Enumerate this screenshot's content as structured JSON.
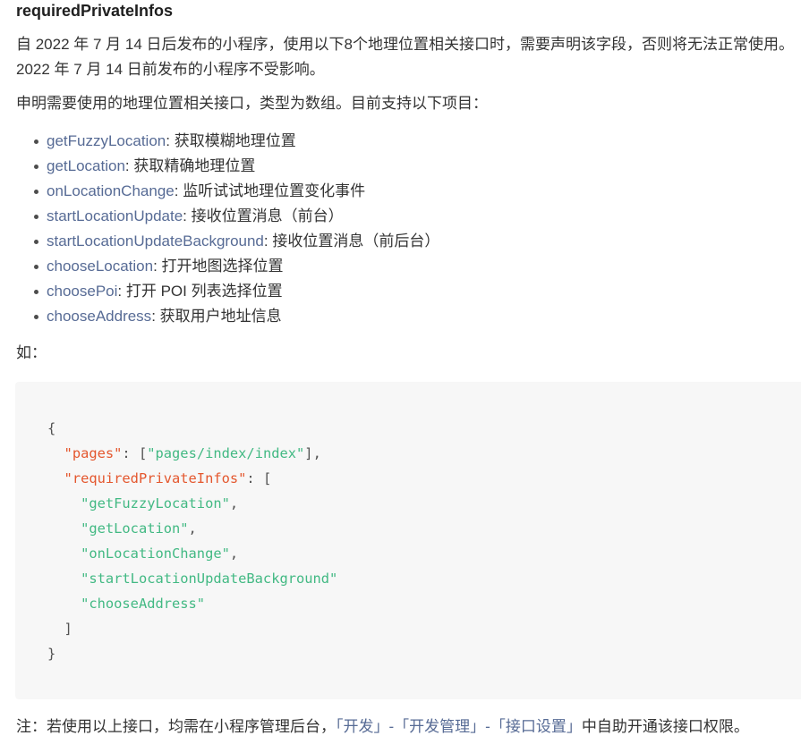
{
  "section": {
    "heading": "requiredPrivateInfos",
    "intro": "自 2022 年 7 月 14 日后发布的小程序，使用以下8个地理位置相关接口时，需要声明该字段，否则将无法正常使用。2022 年 7 月 14 日前发布的小程序不受影响。",
    "list_intro": "申明需要使用的地理位置相关接口，类型为数组。目前支持以下项目："
  },
  "api_list": {
    "separator": ": ",
    "items": [
      {
        "name": "getFuzzyLocation",
        "description": "获取模糊地理位置"
      },
      {
        "name": "getLocation",
        "description": "获取精确地理位置"
      },
      {
        "name": "onLocationChange",
        "description": "监听试试地理位置变化事件"
      },
      {
        "name": "startLocationUpdate",
        "description": "接收位置消息（前台）"
      },
      {
        "name": "startLocationUpdateBackground",
        "description": "接收位置消息（前后台）"
      },
      {
        "name": "chooseLocation",
        "description": "打开地图选择位置"
      },
      {
        "name": "choosePoi",
        "description": "打开 POI 列表选择位置"
      },
      {
        "name": "chooseAddress",
        "description": "获取用户地址信息"
      }
    ]
  },
  "example_label": "如：",
  "code_block": {
    "lines": [
      [
        [
          "punct",
          "{"
        ]
      ],
      [
        [
          "plain",
          "  "
        ],
        [
          "key",
          "\"pages\""
        ],
        [
          "punct",
          ": ["
        ],
        [
          "string",
          "\"pages/index/index\""
        ],
        [
          "punct",
          "],"
        ]
      ],
      [
        [
          "plain",
          "  "
        ],
        [
          "key",
          "\"requiredPrivateInfos\""
        ],
        [
          "punct",
          ": ["
        ]
      ],
      [
        [
          "plain",
          "    "
        ],
        [
          "string",
          "\"getFuzzyLocation\""
        ],
        [
          "punct",
          ","
        ]
      ],
      [
        [
          "plain",
          "    "
        ],
        [
          "string",
          "\"getLocation\""
        ],
        [
          "punct",
          ","
        ]
      ],
      [
        [
          "plain",
          "    "
        ],
        [
          "string",
          "\"onLocationChange\""
        ],
        [
          "punct",
          ","
        ]
      ],
      [
        [
          "plain",
          "    "
        ],
        [
          "string",
          "\"startLocationUpdateBackground\""
        ]
      ],
      [
        [
          "plain",
          "    "
        ],
        [
          "string",
          "\"chooseAddress\""
        ]
      ],
      [
        [
          "plain",
          "  "
        ],
        [
          "punct",
          "]"
        ]
      ],
      [
        [
          "punct",
          "}"
        ]
      ]
    ]
  },
  "note": {
    "prefix": "注：若使用以上接口，均需在小程序管理后台，",
    "link": "「开发」-「开发管理」-「接口设置」",
    "suffix": "中自助开通该接口权限。"
  },
  "colors": {
    "text": "#333333",
    "heading": "#1f1f1f",
    "link": "#576b95",
    "code_background": "#f7f7f7",
    "code_key": "#e4572e",
    "code_string": "#42b983",
    "code_punctuation": "#525252",
    "bullet": "#4d4d4d"
  }
}
